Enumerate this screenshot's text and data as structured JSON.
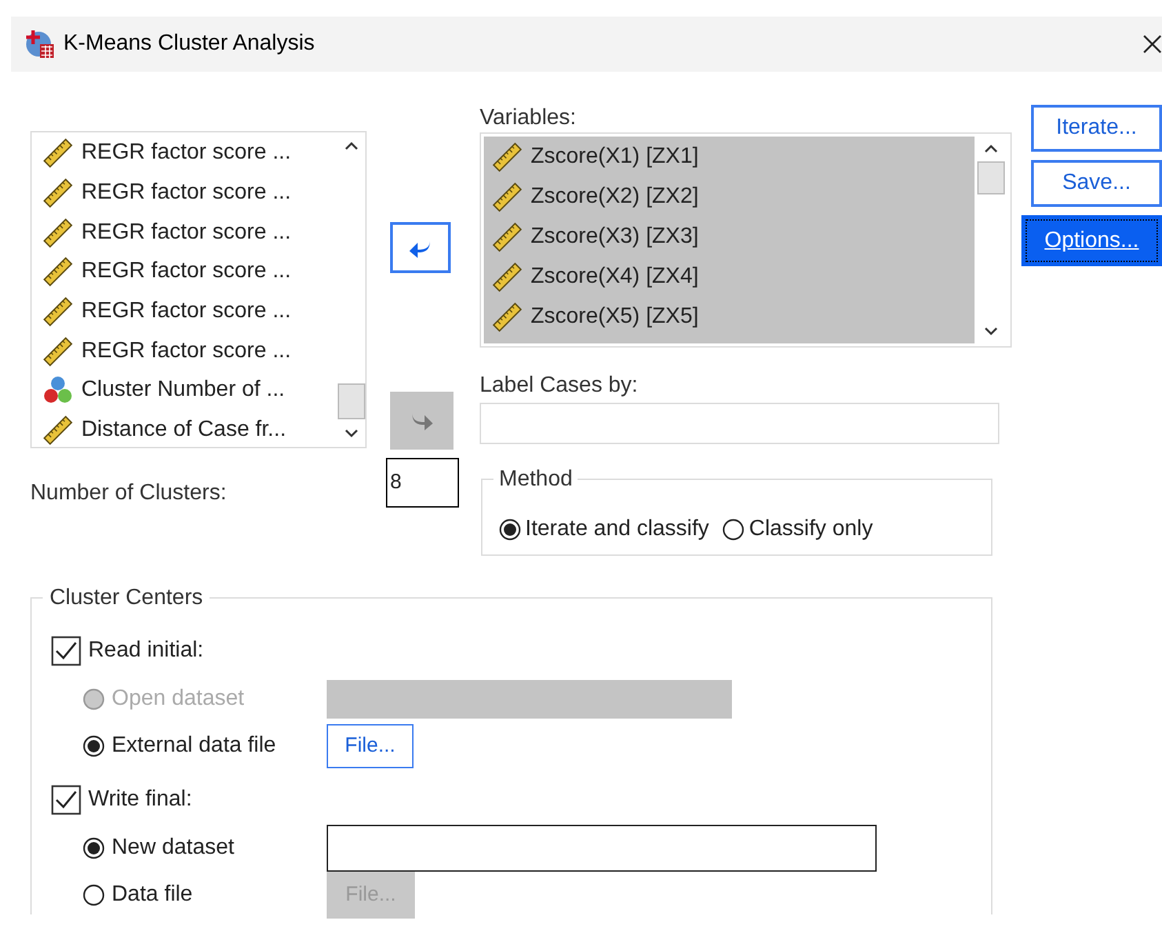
{
  "window": {
    "title": "K-Means Cluster Analysis"
  },
  "source_list": {
    "items": [
      {
        "label": "REGR factor score ...",
        "kind": "scale"
      },
      {
        "label": "REGR factor score ...",
        "kind": "scale"
      },
      {
        "label": "REGR factor score ...",
        "kind": "scale"
      },
      {
        "label": "REGR factor score ...",
        "kind": "scale"
      },
      {
        "label": "REGR factor score ...",
        "kind": "scale"
      },
      {
        "label": "REGR factor score ...",
        "kind": "scale"
      },
      {
        "label": "Cluster Number of ...",
        "kind": "nominal"
      },
      {
        "label": "Distance of Case fr...",
        "kind": "scale"
      }
    ]
  },
  "move_buttons": [
    {
      "disabled": false
    },
    {
      "disabled": true
    }
  ],
  "variables": {
    "label": "Variables:",
    "items": [
      {
        "label": "Zscore(X1) [ZX1]",
        "kind": "scale"
      },
      {
        "label": "Zscore(X2) [ZX2]",
        "kind": "scale"
      },
      {
        "label": "Zscore(X3) [ZX3]",
        "kind": "scale"
      },
      {
        "label": "Zscore(X4) [ZX4]",
        "kind": "scale"
      },
      {
        "label": "Zscore(X5) [ZX5]",
        "kind": "scale"
      }
    ]
  },
  "label_cases": {
    "label": "Label Cases by:"
  },
  "buttons": [
    {
      "label": "Iterate...",
      "selected": false
    },
    {
      "label": "Save...",
      "selected": false
    },
    {
      "label": "Options...",
      "selected": true
    }
  ],
  "number_of_clusters": {
    "label": "Number of Clusters:",
    "value": "8"
  },
  "method": {
    "title": "Method",
    "options": [
      {
        "label": "Iterate and classify",
        "selected": true
      },
      {
        "label": "Classify only",
        "selected": false
      }
    ]
  },
  "cluster_centers": {
    "title": "Cluster Centers",
    "groups": [
      {
        "label": "Read initial:",
        "checked": true,
        "options": [
          {
            "label": "Open dataset",
            "selected": false,
            "disabled": true,
            "kind": "dropdown"
          },
          {
            "label": "External data file",
            "selected": true,
            "disabled": false,
            "kind": "file",
            "button": "File...",
            "button_disabled": false
          }
        ]
      },
      {
        "label": "Write final:",
        "checked": true,
        "options": [
          {
            "label": "New dataset",
            "selected": true,
            "disabled": false,
            "kind": "text"
          },
          {
            "label": "Data file",
            "selected": false,
            "disabled": false,
            "kind": "file",
            "button": "File...",
            "button_disabled": true
          }
        ]
      }
    ]
  }
}
